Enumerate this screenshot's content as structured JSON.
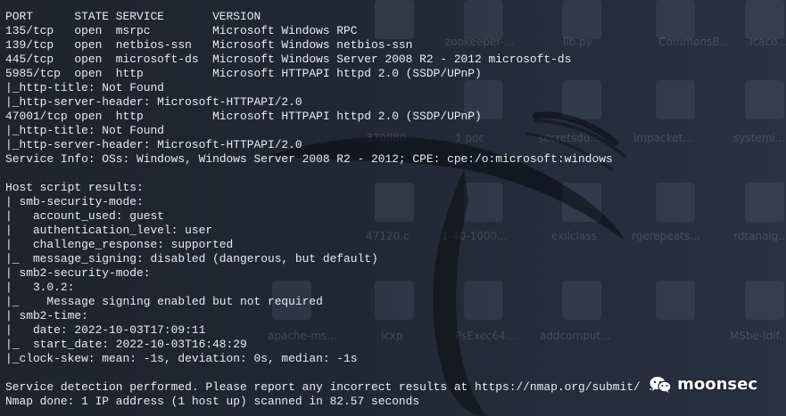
{
  "terminal": {
    "lines": [
      "PORT      STATE SERVICE       VERSION",
      "135/tcp   open  msrpc         Microsoft Windows RPC",
      "139/tcp   open  netbios-ssn   Microsoft Windows netbios-ssn",
      "445/tcp   open  microsoft-ds  Microsoft Windows Server 2008 R2 - 2012 microsoft-ds",
      "5985/tcp  open  http          Microsoft HTTPAPI httpd 2.0 (SSDP/UPnP)",
      "|_http-title: Not Found",
      "|_http-server-header: Microsoft-HTTPAPI/2.0",
      "47001/tcp open  http          Microsoft HTTPAPI httpd 2.0 (SSDP/UPnP)",
      "|_http-title: Not Found",
      "|_http-server-header: Microsoft-HTTPAPI/2.0",
      "Service Info: OSs: Windows, Windows Server 2008 R2 - 2012; CPE: cpe:/o:microsoft:windows",
      "",
      "Host script results:",
      "| smb-security-mode:",
      "|   account_used: guest",
      "|   authentication_level: user",
      "|   challenge_response: supported",
      "|_  message_signing: disabled (dangerous, but default)",
      "| smb2-security-mode:",
      "|   3.0.2:",
      "|_    Message signing enabled but not required",
      "| smb2-time:",
      "|   date: 2022-10-03T17:09:11",
      "|_  start_date: 2022-10-03T16:48:29",
      "|_clock-skew: mean: -1s, deviation: 0s, median: -1s",
      "",
      "Service detection performed. Please report any incorrect results at https://nmap.org/submit/ .",
      "Nmap done: 1 IP address (1 host up) scanned in 82.57 seconds"
    ]
  },
  "desktop": {
    "labels": [
      "zookeeper-...",
      "lib.py",
      "CommonsB...",
      "Icaco...",
      "370880",
      "1.poc",
      "secretsdu...",
      "impacket...",
      "systemi...",
      "47120.c",
      "1-40-1000...",
      "exilclass",
      "rgerepeats...",
      "rdtanalg...",
      "apache-ms...",
      "icxp",
      "PsExec64...",
      "addcomput...",
      "MSbe-ldif..."
    ]
  },
  "watermark": {
    "icon": "wechat-icon",
    "text": "moonsec"
  }
}
